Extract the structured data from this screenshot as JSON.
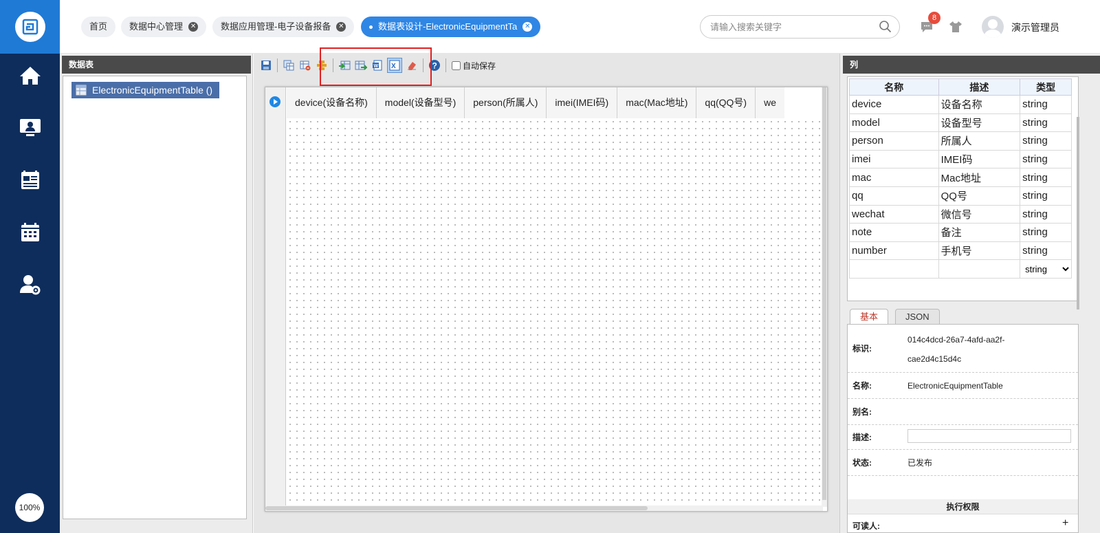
{
  "nav": {
    "items": [
      "home-icon",
      "monitor-user-icon",
      "report-icon",
      "calendar-icon",
      "user-settings-icon"
    ],
    "zoom": "100%"
  },
  "tabs": [
    {
      "label": "首页",
      "closable": false
    },
    {
      "label": "数据中心管理",
      "closable": true
    },
    {
      "label": "数据应用管理-电子设备报备",
      "closable": true
    },
    {
      "label": "数据表设计-ElectronicEquipmentTa",
      "closable": true,
      "active": true
    }
  ],
  "header": {
    "search_placeholder": "请输入搜索关键字",
    "badge_count": "8",
    "user_name": "演示管理员"
  },
  "left_panel": {
    "title": "数据表",
    "tree_item": "ElectronicEquipmentTable ()"
  },
  "toolbar": {
    "autosave_label": "自动保存",
    "autosave_checked": false
  },
  "grid": {
    "columns": [
      "device(设备名称)",
      "model(设备型号)",
      "person(所属人)",
      "imei(IMEI码)",
      "mac(Mac地址)",
      "qq(QQ号)",
      "we"
    ]
  },
  "right_panel": {
    "title": "列",
    "headers": [
      "名称",
      "描述",
      "类型"
    ],
    "rows": [
      {
        "name": "device",
        "desc": "设备名称",
        "type": "string"
      },
      {
        "name": "model",
        "desc": "设备型号",
        "type": "string"
      },
      {
        "name": "person",
        "desc": "所属人",
        "type": "string"
      },
      {
        "name": "imei",
        "desc": "IMEI码",
        "type": "string"
      },
      {
        "name": "mac",
        "desc": "Mac地址",
        "type": "string"
      },
      {
        "name": "qq",
        "desc": "QQ号",
        "type": "string"
      },
      {
        "name": "wechat",
        "desc": "微信号",
        "type": "string"
      },
      {
        "name": "note",
        "desc": "备注",
        "type": "string"
      },
      {
        "name": "number",
        "desc": "手机号",
        "type": "string"
      }
    ],
    "new_row_type": "string"
  },
  "props": {
    "tabs": [
      "基本",
      "JSON"
    ],
    "id_label": "标识:",
    "id_line1": "014c4dcd-26a7-4afd-aa2f-",
    "id_line2": "cae2d4c15d4c",
    "name_label": "名称:",
    "name_value": "ElectronicEquipmentTable",
    "alias_label": "别名:",
    "desc_label": "描述:",
    "status_label": "状态:",
    "status_value": "已发布",
    "permission_header": "执行权限",
    "reader_label": "可读人:",
    "plus": "+"
  }
}
